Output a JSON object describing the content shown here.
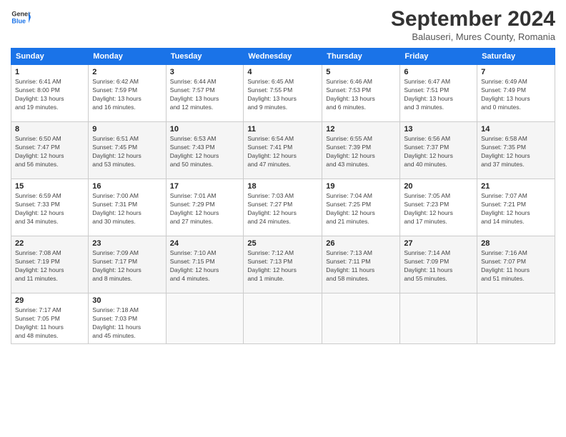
{
  "header": {
    "logo_line1": "General",
    "logo_line2": "Blue",
    "month": "September 2024",
    "location": "Balauseri, Mures County, Romania"
  },
  "weekdays": [
    "Sunday",
    "Monday",
    "Tuesday",
    "Wednesday",
    "Thursday",
    "Friday",
    "Saturday"
  ],
  "weeks": [
    [
      {
        "day": "1",
        "info": "Sunrise: 6:41 AM\nSunset: 8:00 PM\nDaylight: 13 hours\nand 19 minutes."
      },
      {
        "day": "2",
        "info": "Sunrise: 6:42 AM\nSunset: 7:59 PM\nDaylight: 13 hours\nand 16 minutes."
      },
      {
        "day": "3",
        "info": "Sunrise: 6:44 AM\nSunset: 7:57 PM\nDaylight: 13 hours\nand 12 minutes."
      },
      {
        "day": "4",
        "info": "Sunrise: 6:45 AM\nSunset: 7:55 PM\nDaylight: 13 hours\nand 9 minutes."
      },
      {
        "day": "5",
        "info": "Sunrise: 6:46 AM\nSunset: 7:53 PM\nDaylight: 13 hours\nand 6 minutes."
      },
      {
        "day": "6",
        "info": "Sunrise: 6:47 AM\nSunset: 7:51 PM\nDaylight: 13 hours\nand 3 minutes."
      },
      {
        "day": "7",
        "info": "Sunrise: 6:49 AM\nSunset: 7:49 PM\nDaylight: 13 hours\nand 0 minutes."
      }
    ],
    [
      {
        "day": "8",
        "info": "Sunrise: 6:50 AM\nSunset: 7:47 PM\nDaylight: 12 hours\nand 56 minutes."
      },
      {
        "day": "9",
        "info": "Sunrise: 6:51 AM\nSunset: 7:45 PM\nDaylight: 12 hours\nand 53 minutes."
      },
      {
        "day": "10",
        "info": "Sunrise: 6:53 AM\nSunset: 7:43 PM\nDaylight: 12 hours\nand 50 minutes."
      },
      {
        "day": "11",
        "info": "Sunrise: 6:54 AM\nSunset: 7:41 PM\nDaylight: 12 hours\nand 47 minutes."
      },
      {
        "day": "12",
        "info": "Sunrise: 6:55 AM\nSunset: 7:39 PM\nDaylight: 12 hours\nand 43 minutes."
      },
      {
        "day": "13",
        "info": "Sunrise: 6:56 AM\nSunset: 7:37 PM\nDaylight: 12 hours\nand 40 minutes."
      },
      {
        "day": "14",
        "info": "Sunrise: 6:58 AM\nSunset: 7:35 PM\nDaylight: 12 hours\nand 37 minutes."
      }
    ],
    [
      {
        "day": "15",
        "info": "Sunrise: 6:59 AM\nSunset: 7:33 PM\nDaylight: 12 hours\nand 34 minutes."
      },
      {
        "day": "16",
        "info": "Sunrise: 7:00 AM\nSunset: 7:31 PM\nDaylight: 12 hours\nand 30 minutes."
      },
      {
        "day": "17",
        "info": "Sunrise: 7:01 AM\nSunset: 7:29 PM\nDaylight: 12 hours\nand 27 minutes."
      },
      {
        "day": "18",
        "info": "Sunrise: 7:03 AM\nSunset: 7:27 PM\nDaylight: 12 hours\nand 24 minutes."
      },
      {
        "day": "19",
        "info": "Sunrise: 7:04 AM\nSunset: 7:25 PM\nDaylight: 12 hours\nand 21 minutes."
      },
      {
        "day": "20",
        "info": "Sunrise: 7:05 AM\nSunset: 7:23 PM\nDaylight: 12 hours\nand 17 minutes."
      },
      {
        "day": "21",
        "info": "Sunrise: 7:07 AM\nSunset: 7:21 PM\nDaylight: 12 hours\nand 14 minutes."
      }
    ],
    [
      {
        "day": "22",
        "info": "Sunrise: 7:08 AM\nSunset: 7:19 PM\nDaylight: 12 hours\nand 11 minutes."
      },
      {
        "day": "23",
        "info": "Sunrise: 7:09 AM\nSunset: 7:17 PM\nDaylight: 12 hours\nand 8 minutes."
      },
      {
        "day": "24",
        "info": "Sunrise: 7:10 AM\nSunset: 7:15 PM\nDaylight: 12 hours\nand 4 minutes."
      },
      {
        "day": "25",
        "info": "Sunrise: 7:12 AM\nSunset: 7:13 PM\nDaylight: 12 hours\nand 1 minute."
      },
      {
        "day": "26",
        "info": "Sunrise: 7:13 AM\nSunset: 7:11 PM\nDaylight: 11 hours\nand 58 minutes."
      },
      {
        "day": "27",
        "info": "Sunrise: 7:14 AM\nSunset: 7:09 PM\nDaylight: 11 hours\nand 55 minutes."
      },
      {
        "day": "28",
        "info": "Sunrise: 7:16 AM\nSunset: 7:07 PM\nDaylight: 11 hours\nand 51 minutes."
      }
    ],
    [
      {
        "day": "29",
        "info": "Sunrise: 7:17 AM\nSunset: 7:05 PM\nDaylight: 11 hours\nand 48 minutes."
      },
      {
        "day": "30",
        "info": "Sunrise: 7:18 AM\nSunset: 7:03 PM\nDaylight: 11 hours\nand 45 minutes."
      },
      null,
      null,
      null,
      null,
      null
    ]
  ]
}
